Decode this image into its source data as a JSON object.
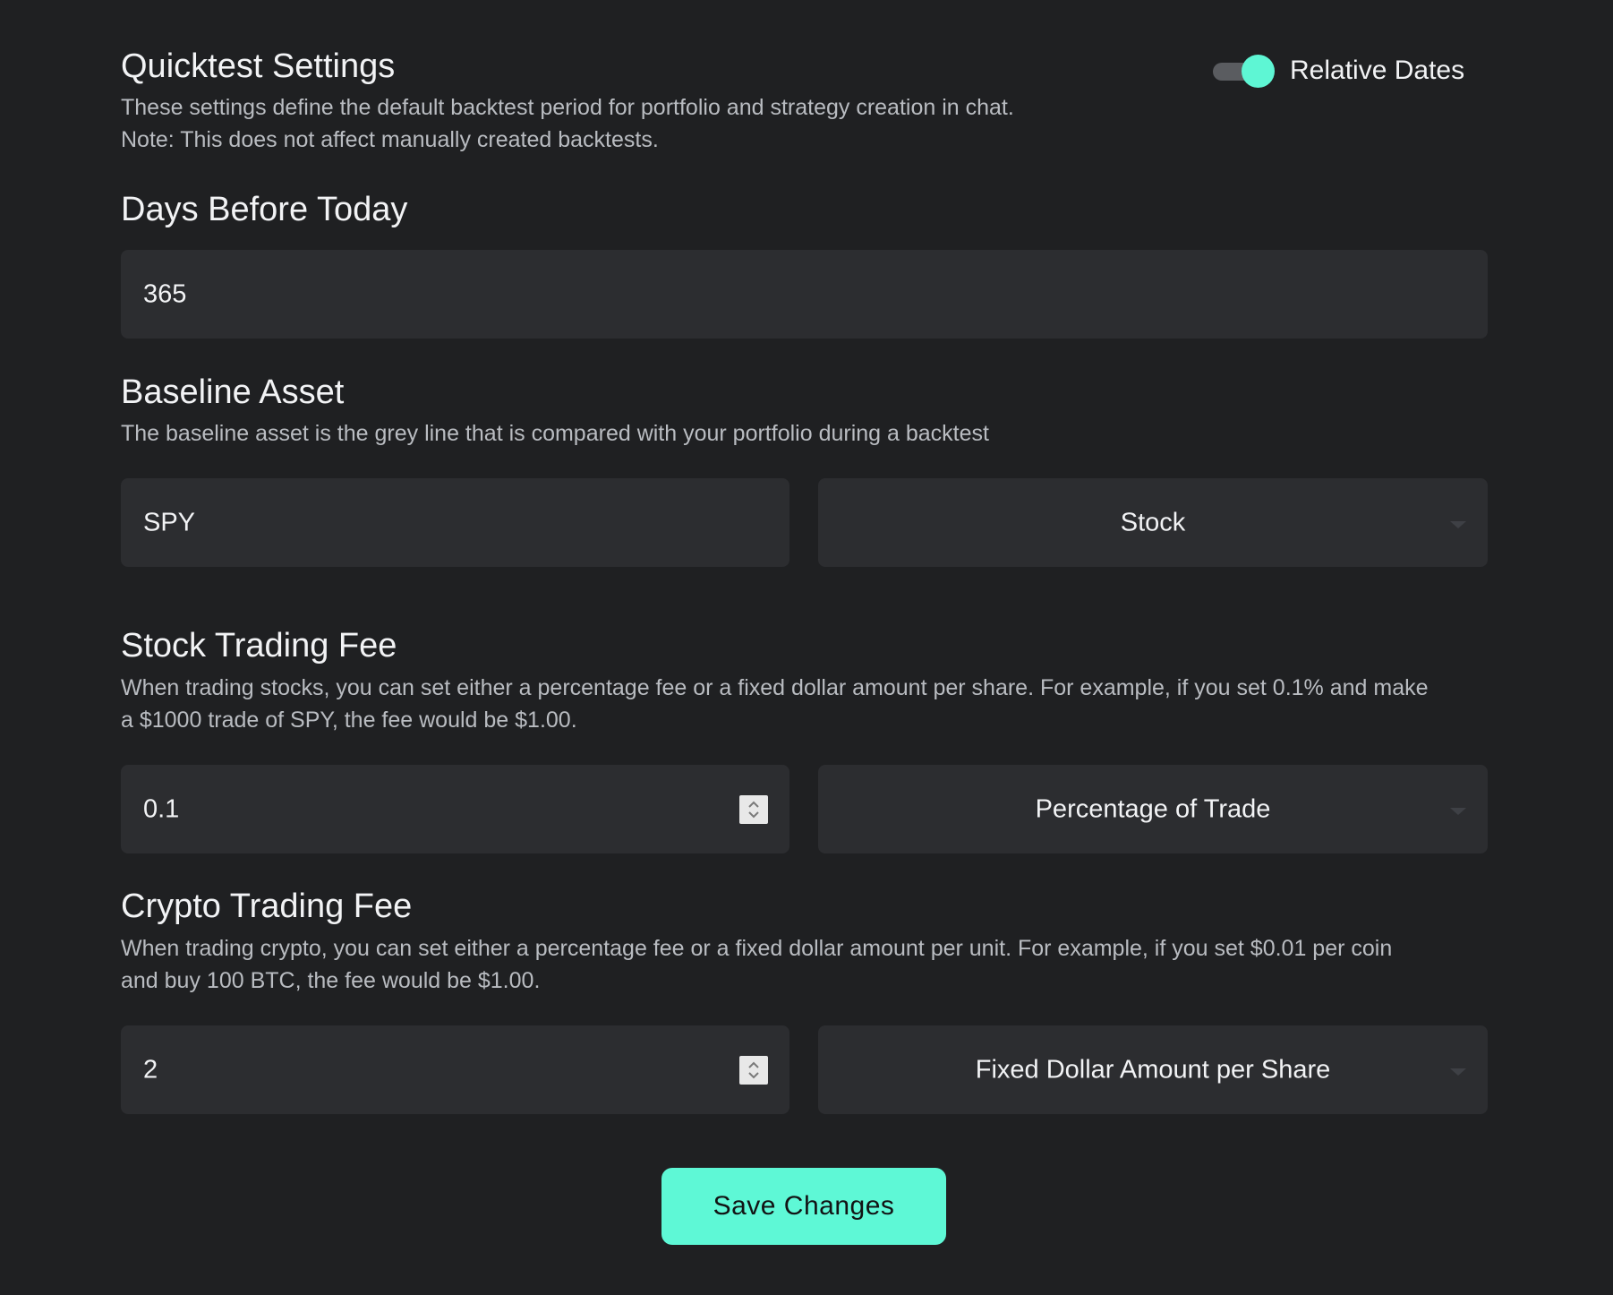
{
  "quicktest": {
    "title": "Quicktest Settings",
    "description_line1": "These settings define the default backtest period for portfolio and strategy creation in chat.",
    "description_line2": "Note: This does not affect manually created backtests.",
    "toggle_label": "Relative Dates",
    "toggle_on": true
  },
  "days_before_today": {
    "title": "Days Before Today",
    "value": "365"
  },
  "baseline_asset": {
    "title": "Baseline Asset",
    "description": "The baseline asset is the grey line that is compared with your portfolio during a backtest",
    "symbol_value": "SPY",
    "type_selected": "Stock"
  },
  "stock_fee": {
    "title": "Stock Trading Fee",
    "description_line1": "When trading stocks, you can set either a percentage fee or a fixed dollar amount per share. For example, if you set 0.1% and make",
    "description_line2": "a $1000 trade of SPY, the fee would be $1.00.",
    "value": "0.1",
    "mode_selected": "Percentage of Trade"
  },
  "crypto_fee": {
    "title": "Crypto Trading Fee",
    "description_line1": "When trading crypto, you can set either a percentage fee or a fixed dollar amount per unit. For example, if you set $0.01 per coin",
    "description_line2": "and buy 100 BTC, the fee would be $1.00.",
    "value": "2",
    "mode_selected": "Fixed Dollar Amount per Share"
  },
  "actions": {
    "save_label": "Save Changes"
  },
  "colors": {
    "background": "#1f2022",
    "field": "#2c2d30",
    "accent": "#5ef8d6"
  }
}
